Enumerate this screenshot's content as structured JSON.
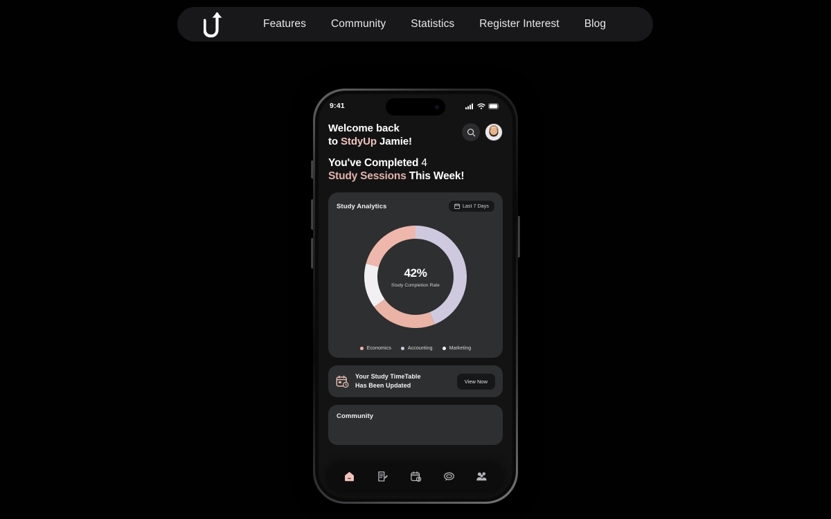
{
  "site": {
    "logo_name": "u-turn-arrow-logo",
    "nav_items": [
      {
        "label": "Features"
      },
      {
        "label": "Community"
      },
      {
        "label": "Statistics"
      },
      {
        "label": "Register Interest"
      },
      {
        "label": "Blog"
      }
    ]
  },
  "phone": {
    "status_bar": {
      "time": "9:41",
      "icons": [
        "cellular-signal-icon",
        "wifi-icon",
        "battery-icon"
      ]
    },
    "header": {
      "greeting_line1": "Welcome back",
      "greeting_line2_prefix": "to ",
      "brand": "StdyUp",
      "greeting_line2_suffix": " Jamie!",
      "search_icon": "search-icon",
      "avatar": "user-avatar"
    },
    "headline": {
      "line1_lead": "You've Completed ",
      "line1_count": "4",
      "line2_accent": "Study Sessions",
      "line2_rest": " This Week!"
    },
    "analytics_card": {
      "title": "Study Analytics",
      "range_chip": {
        "label": "Last 7 Days",
        "icon": "calendar-icon"
      },
      "center_value": "42%",
      "center_label": "Study Completion Rate",
      "legend": [
        {
          "label": "Economics",
          "color": "#efb7ab"
        },
        {
          "label": "Accounting",
          "color": "#cfc9e0"
        },
        {
          "label": "Marketing",
          "color": "#f4f4f6"
        }
      ]
    },
    "timetable_banner": {
      "icon": "calendar-updated-icon",
      "line1": "Your Study TimeTable",
      "line2": "Has Been Updated",
      "button_label": "View Now"
    },
    "community_card": {
      "title": "Community"
    },
    "tabbar": [
      {
        "name": "home-icon",
        "active": true
      },
      {
        "name": "notes-icon",
        "active": false
      },
      {
        "name": "schedule-icon",
        "active": false
      },
      {
        "name": "chat-icon",
        "active": false
      },
      {
        "name": "people-icon",
        "active": false
      }
    ]
  },
  "chart_data": {
    "type": "pie",
    "title": "Study Analytics",
    "center_value": "42%",
    "center_label": "Study Completion Rate",
    "donut": true,
    "start_angle_deg": 0,
    "legend_position": "bottom",
    "categories": [
      "Accounting",
      "Economics",
      "Marketing",
      "Economics"
    ],
    "values": [
      44,
      21,
      14,
      21
    ],
    "segments": [
      {
        "label": "Accounting",
        "value": 44,
        "color": "#cfc9e0",
        "start_deg": 0,
        "end_deg": 158
      },
      {
        "label": "Economics",
        "value": 21,
        "color": "#eab3a5",
        "start_deg": 158,
        "end_deg": 234
      },
      {
        "label": "Marketing",
        "value": 14,
        "color": "#f2eff3",
        "start_deg": 234,
        "end_deg": 285
      },
      {
        "label": "Economics",
        "value": 21,
        "color": "#efb7ab",
        "start_deg": 285,
        "end_deg": 360
      }
    ]
  }
}
